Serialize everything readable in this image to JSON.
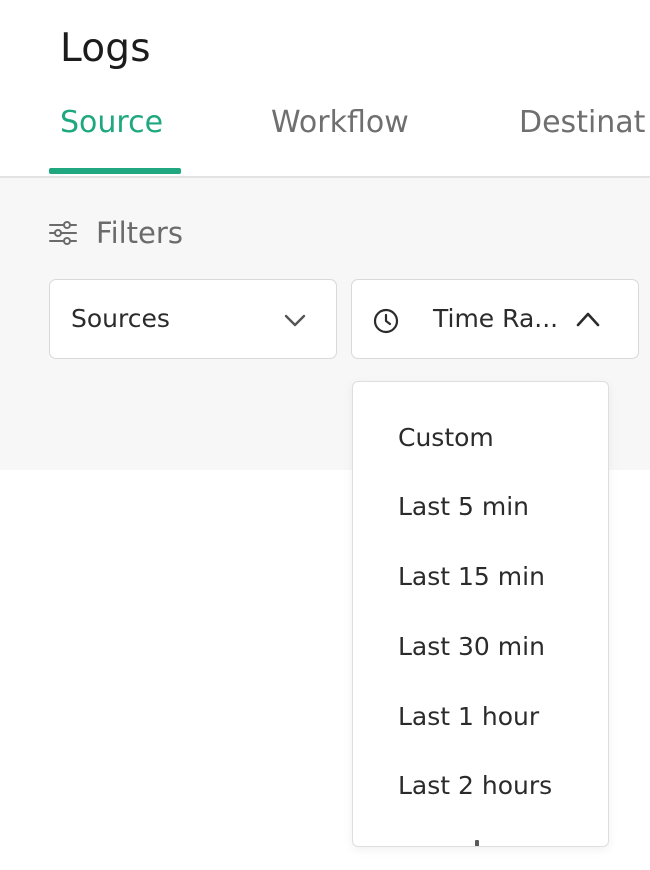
{
  "page": {
    "title": "Logs"
  },
  "tabs": [
    {
      "label": "Source",
      "active": true
    },
    {
      "label": "Workflow",
      "active": false
    },
    {
      "label": "Destinat",
      "active": false
    }
  ],
  "filters": {
    "heading": "Filters",
    "heading_icon": "sliders-icon",
    "sources_select": {
      "value": "Sources",
      "icon": "chevron-down-icon"
    },
    "time_range_select": {
      "value": "Time Ra...",
      "leading_icon": "clock-icon",
      "icon": "chevron-up-icon",
      "expanded": true
    }
  },
  "time_range_options": [
    "Custom",
    "Last 5 min",
    "Last 15 min",
    "Last 30 min",
    "Last 1 hour",
    "Last 2 hours"
  ],
  "colors": {
    "accent": "#1fa87f",
    "muted_text": "#6f6f6f",
    "panel_bg": "#f7f7f7",
    "border": "#d9d9d9"
  }
}
